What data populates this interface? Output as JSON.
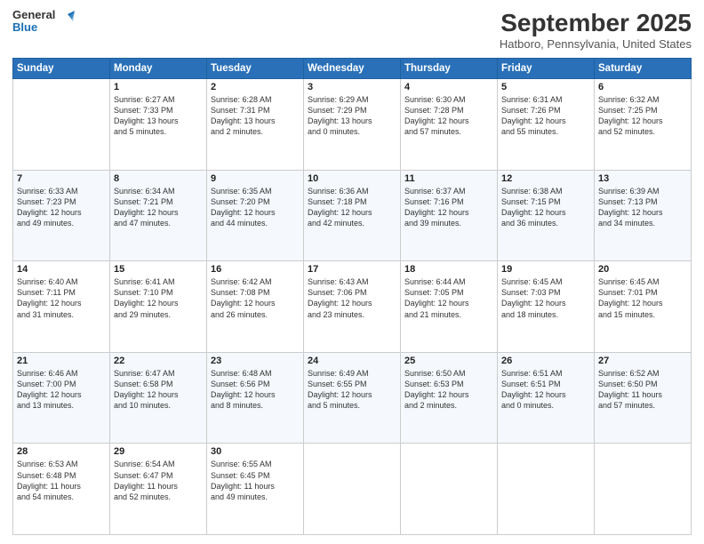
{
  "header": {
    "logo_line1": "General",
    "logo_line2": "Blue",
    "month_title": "September 2025",
    "location": "Hatboro, Pennsylvania, United States"
  },
  "days_of_week": [
    "Sunday",
    "Monday",
    "Tuesday",
    "Wednesday",
    "Thursday",
    "Friday",
    "Saturday"
  ],
  "weeks": [
    [
      {
        "day": "",
        "info": ""
      },
      {
        "day": "1",
        "info": "Sunrise: 6:27 AM\nSunset: 7:33 PM\nDaylight: 13 hours\nand 5 minutes."
      },
      {
        "day": "2",
        "info": "Sunrise: 6:28 AM\nSunset: 7:31 PM\nDaylight: 13 hours\nand 2 minutes."
      },
      {
        "day": "3",
        "info": "Sunrise: 6:29 AM\nSunset: 7:29 PM\nDaylight: 13 hours\nand 0 minutes."
      },
      {
        "day": "4",
        "info": "Sunrise: 6:30 AM\nSunset: 7:28 PM\nDaylight: 12 hours\nand 57 minutes."
      },
      {
        "day": "5",
        "info": "Sunrise: 6:31 AM\nSunset: 7:26 PM\nDaylight: 12 hours\nand 55 minutes."
      },
      {
        "day": "6",
        "info": "Sunrise: 6:32 AM\nSunset: 7:25 PM\nDaylight: 12 hours\nand 52 minutes."
      }
    ],
    [
      {
        "day": "7",
        "info": "Sunrise: 6:33 AM\nSunset: 7:23 PM\nDaylight: 12 hours\nand 49 minutes."
      },
      {
        "day": "8",
        "info": "Sunrise: 6:34 AM\nSunset: 7:21 PM\nDaylight: 12 hours\nand 47 minutes."
      },
      {
        "day": "9",
        "info": "Sunrise: 6:35 AM\nSunset: 7:20 PM\nDaylight: 12 hours\nand 44 minutes."
      },
      {
        "day": "10",
        "info": "Sunrise: 6:36 AM\nSunset: 7:18 PM\nDaylight: 12 hours\nand 42 minutes."
      },
      {
        "day": "11",
        "info": "Sunrise: 6:37 AM\nSunset: 7:16 PM\nDaylight: 12 hours\nand 39 minutes."
      },
      {
        "day": "12",
        "info": "Sunrise: 6:38 AM\nSunset: 7:15 PM\nDaylight: 12 hours\nand 36 minutes."
      },
      {
        "day": "13",
        "info": "Sunrise: 6:39 AM\nSunset: 7:13 PM\nDaylight: 12 hours\nand 34 minutes."
      }
    ],
    [
      {
        "day": "14",
        "info": "Sunrise: 6:40 AM\nSunset: 7:11 PM\nDaylight: 12 hours\nand 31 minutes."
      },
      {
        "day": "15",
        "info": "Sunrise: 6:41 AM\nSunset: 7:10 PM\nDaylight: 12 hours\nand 29 minutes."
      },
      {
        "day": "16",
        "info": "Sunrise: 6:42 AM\nSunset: 7:08 PM\nDaylight: 12 hours\nand 26 minutes."
      },
      {
        "day": "17",
        "info": "Sunrise: 6:43 AM\nSunset: 7:06 PM\nDaylight: 12 hours\nand 23 minutes."
      },
      {
        "day": "18",
        "info": "Sunrise: 6:44 AM\nSunset: 7:05 PM\nDaylight: 12 hours\nand 21 minutes."
      },
      {
        "day": "19",
        "info": "Sunrise: 6:45 AM\nSunset: 7:03 PM\nDaylight: 12 hours\nand 18 minutes."
      },
      {
        "day": "20",
        "info": "Sunrise: 6:45 AM\nSunset: 7:01 PM\nDaylight: 12 hours\nand 15 minutes."
      }
    ],
    [
      {
        "day": "21",
        "info": "Sunrise: 6:46 AM\nSunset: 7:00 PM\nDaylight: 12 hours\nand 13 minutes."
      },
      {
        "day": "22",
        "info": "Sunrise: 6:47 AM\nSunset: 6:58 PM\nDaylight: 12 hours\nand 10 minutes."
      },
      {
        "day": "23",
        "info": "Sunrise: 6:48 AM\nSunset: 6:56 PM\nDaylight: 12 hours\nand 8 minutes."
      },
      {
        "day": "24",
        "info": "Sunrise: 6:49 AM\nSunset: 6:55 PM\nDaylight: 12 hours\nand 5 minutes."
      },
      {
        "day": "25",
        "info": "Sunrise: 6:50 AM\nSunset: 6:53 PM\nDaylight: 12 hours\nand 2 minutes."
      },
      {
        "day": "26",
        "info": "Sunrise: 6:51 AM\nSunset: 6:51 PM\nDaylight: 12 hours\nand 0 minutes."
      },
      {
        "day": "27",
        "info": "Sunrise: 6:52 AM\nSunset: 6:50 PM\nDaylight: 11 hours\nand 57 minutes."
      }
    ],
    [
      {
        "day": "28",
        "info": "Sunrise: 6:53 AM\nSunset: 6:48 PM\nDaylight: 11 hours\nand 54 minutes."
      },
      {
        "day": "29",
        "info": "Sunrise: 6:54 AM\nSunset: 6:47 PM\nDaylight: 11 hours\nand 52 minutes."
      },
      {
        "day": "30",
        "info": "Sunrise: 6:55 AM\nSunset: 6:45 PM\nDaylight: 11 hours\nand 49 minutes."
      },
      {
        "day": "",
        "info": ""
      },
      {
        "day": "",
        "info": ""
      },
      {
        "day": "",
        "info": ""
      },
      {
        "day": "",
        "info": ""
      }
    ]
  ]
}
